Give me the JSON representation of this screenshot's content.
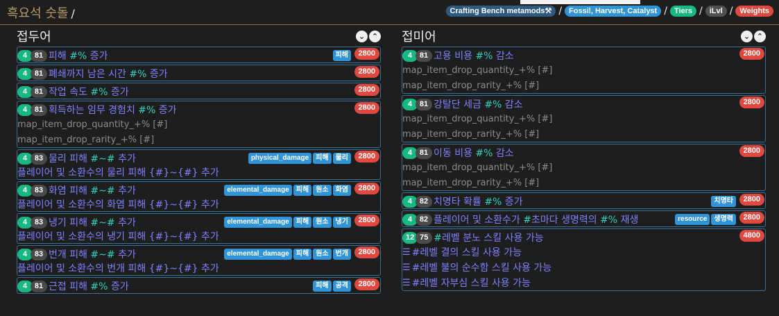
{
  "header": {
    "title": "흑요석 숫돌",
    "title_sep": "/",
    "crumbs": [
      {
        "label": "Crafting Bench metamods⚒",
        "style": "pill-dark"
      },
      {
        "label": "Fossil, Harvest, Catalyst",
        "style": "pill-blue"
      },
      {
        "label": "Tiers",
        "style": "pill-green"
      },
      {
        "label": "iLvl",
        "style": "pill-gray"
      },
      {
        "label": "Weights",
        "style": "pill-red"
      }
    ],
    "sep": "/"
  },
  "left": {
    "title": "접두어",
    "mods": [
      {
        "tier": "4",
        "ilvl": "81",
        "text": [
          "피해 ",
          "#%",
          " 증가"
        ],
        "tags": [
          "피해"
        ],
        "weight": "2800",
        "subs": []
      },
      {
        "tier": "4",
        "ilvl": "81",
        "text": [
          "폐쇄까지 남은 시간 ",
          "#%",
          " 증가"
        ],
        "tags": [],
        "weight": "2800",
        "subs": []
      },
      {
        "tier": "4",
        "ilvl": "81",
        "text": [
          "작업 속도 ",
          "#%",
          " 증가"
        ],
        "tags": [],
        "weight": "2800",
        "subs": []
      },
      {
        "tier": "4",
        "ilvl": "81",
        "text": [
          "획득하는 임무 경험치 ",
          "#%",
          " 증가"
        ],
        "tags": [],
        "weight": "2800",
        "subs": [
          "map_item_drop_quantity_+% [#]",
          "map_item_drop_rarity_+% [#]"
        ]
      },
      {
        "tier": "4",
        "ilvl": "83",
        "text": [
          "물리 피해 ",
          "#~#",
          " 추가"
        ],
        "tags": [
          "physical_damage",
          "피해",
          "물리"
        ],
        "weight": "2800",
        "line2": "플레이어 및 소환수의 물리 피해 {#}~{#} 추가",
        "subs": []
      },
      {
        "tier": "4",
        "ilvl": "83",
        "text": [
          "화염 피해 ",
          "#~#",
          " 추가"
        ],
        "tags": [
          "elemental_damage",
          "피해",
          "원소",
          "화염"
        ],
        "weight": "2800",
        "line2": "플레이어 및 소환수의 화염 피해 {#}~{#} 추가",
        "subs": []
      },
      {
        "tier": "4",
        "ilvl": "83",
        "text": [
          "냉기 피해 ",
          "#~#",
          " 추가"
        ],
        "tags": [
          "elemental_damage",
          "피해",
          "원소",
          "냉기"
        ],
        "weight": "2800",
        "line2": "플레이어 및 소환수의 냉기 피해 {#}~{#} 추가",
        "subs": []
      },
      {
        "tier": "4",
        "ilvl": "83",
        "text": [
          "번개 피해 ",
          "#~#",
          " 추가"
        ],
        "tags": [
          "elemental_damage",
          "피해",
          "원소",
          "번개"
        ],
        "weight": "2800",
        "line2": "플레이어 및 소환수의 번개 피해 {#}~{#} 추가",
        "subs": []
      },
      {
        "tier": "4",
        "ilvl": "81",
        "text": [
          "근접 피해 ",
          "#%",
          " 증가"
        ],
        "tags": [
          "피해",
          "공격"
        ],
        "weight": "2800",
        "subs": []
      }
    ]
  },
  "right": {
    "title": "접미어",
    "mods": [
      {
        "tier": "4",
        "ilvl": "81",
        "text": [
          "고용 비용 ",
          "#%",
          " 감소"
        ],
        "tags": [],
        "weight": "2800",
        "subs": [
          "map_item_drop_quantity_+% [#]",
          "map_item_drop_rarity_+% [#]"
        ]
      },
      {
        "tier": "4",
        "ilvl": "81",
        "text": [
          "강탈단 세금 ",
          "#%",
          " 감소"
        ],
        "tags": [],
        "weight": "2800",
        "subs": [
          "map_item_drop_quantity_+% [#]",
          "map_item_drop_rarity_+% [#]"
        ]
      },
      {
        "tier": "4",
        "ilvl": "81",
        "text": [
          "이동 비용 ",
          "#%",
          " 감소"
        ],
        "tags": [],
        "weight": "2800",
        "subs": [
          "map_item_drop_quantity_+% [#]",
          "map_item_drop_rarity_+% [#]"
        ]
      },
      {
        "tier": "4",
        "ilvl": "82",
        "text": [
          "치명타 확률 ",
          "#%",
          " 증가"
        ],
        "tags": [
          "치명타"
        ],
        "weight": "2800",
        "subs": []
      },
      {
        "tier": "4",
        "ilvl": "82",
        "text": [
          "플레이어 및 소환수가 ",
          "#",
          "초마다 생명력의 ",
          "#%",
          " 재생"
        ],
        "tags": [
          "resource",
          "생명력"
        ],
        "weight": "2800",
        "subs": []
      },
      {
        "tier": "12",
        "ilvl": "75",
        "text": [
          "#",
          "레벨 분노 스킬 사용 가능"
        ],
        "tags": [],
        "weight": "4800",
        "subs": [],
        "list": [
          "#레벨 결의 스킬 사용 가능",
          "#레벨 불의 순수함 스킬 사용 가능",
          "#레벨 자부심 스킬 사용 가능"
        ]
      }
    ]
  },
  "toggles": {
    "down": "⌄",
    "up": "⌃"
  }
}
